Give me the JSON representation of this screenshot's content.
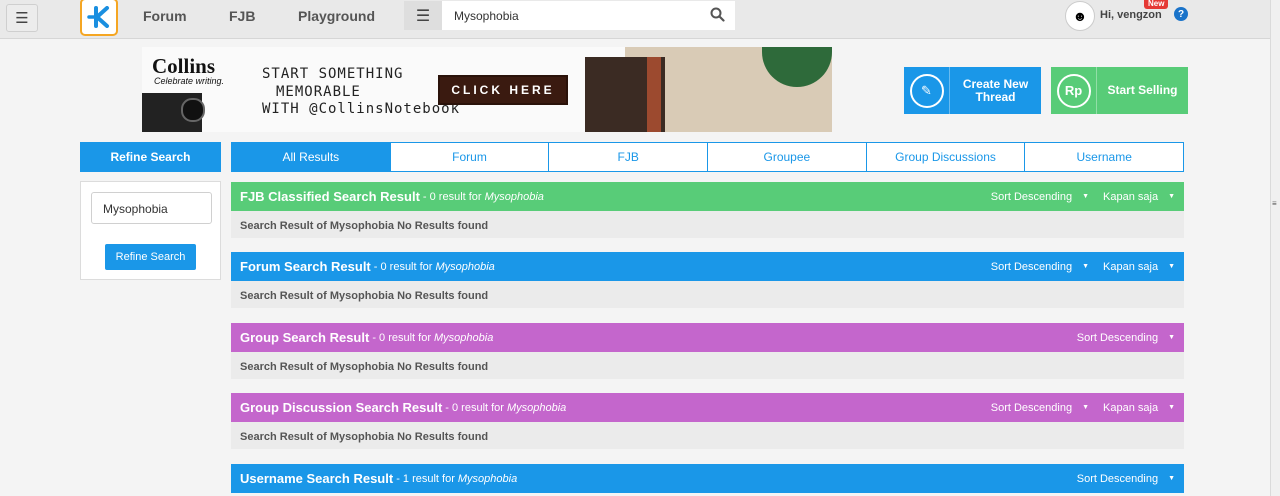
{
  "header": {
    "nav": [
      "Forum",
      "FJB",
      "Playground"
    ],
    "search_value": "Mysophobia",
    "new_badge": "New",
    "greeting": "Hi, vengzon",
    "help": "?"
  },
  "banner": {
    "brand": "Collins",
    "tagline": "Celebrate writing.",
    "lines": [
      "START SOMETHING",
      "MEMORABLE",
      "WITH @CollinsNotebook"
    ],
    "cta": "CLICK HERE"
  },
  "actions": {
    "create_thread": "Create New Thread",
    "start_selling": "Start Selling",
    "rp_label": "Rp"
  },
  "refine": {
    "header": "Refine Search",
    "input_value": "Mysophobia",
    "button": "Refine Search"
  },
  "tabs": [
    "All Results",
    "Forum",
    "FJB",
    "Groupee",
    "Group Discussions",
    "Username"
  ],
  "colors": {
    "blue": "#1a97e8",
    "green": "#58cc78",
    "purple": "#c466cc"
  },
  "sections": [
    {
      "title": "FJB Classified Search Result",
      "count_text": "- 0 result for",
      "term": "Mysophobia",
      "sort": "Sort Descending",
      "time": "Kapan saja",
      "body": "Search Result of Mysophobia No Results found"
    },
    {
      "title": "Forum Search Result",
      "count_text": "- 0 result for",
      "term": "Mysophobia",
      "sort": "Sort Descending",
      "time": "Kapan saja",
      "body": "Search Result of Mysophobia No Results found"
    },
    {
      "title": "Group Search Result",
      "count_text": "- 0 result for",
      "term": "Mysophobia",
      "sort": "Sort Descending",
      "body": "Search Result of Mysophobia No Results found"
    },
    {
      "title": "Group Discussion Search Result",
      "count_text": "- 0 result for",
      "term": "Mysophobia",
      "sort": "Sort Descending",
      "time": "Kapan saja",
      "body": "Search Result of Mysophobia No Results found"
    },
    {
      "title": "Username Search Result",
      "count_text": "- 1 result for",
      "term": "Mysophobia",
      "sort": "Sort Descending"
    }
  ]
}
